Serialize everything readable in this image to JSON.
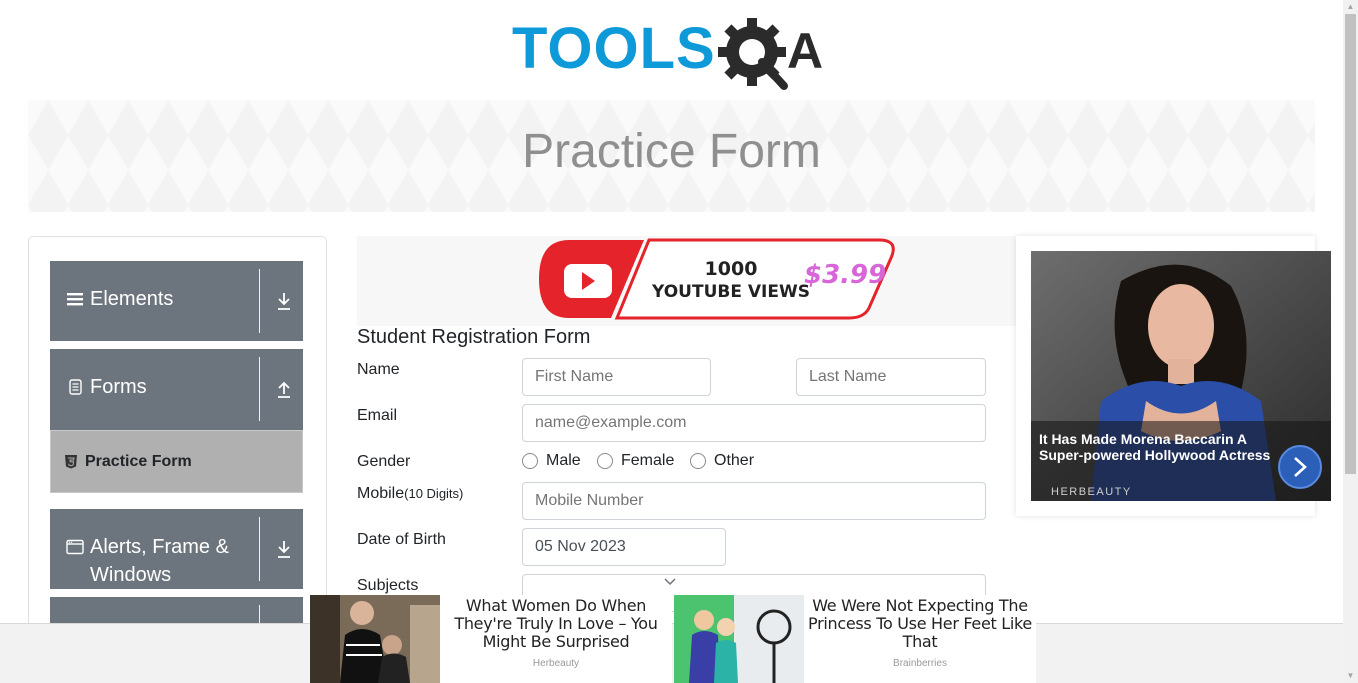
{
  "page": {
    "banner_title": "Practice Form"
  },
  "logo": {
    "text_left": "TOOLS",
    "text_right": "A",
    "color_primary": "#0e99d8",
    "color_dark": "#2b2b2b"
  },
  "sidebar": {
    "groups": [
      {
        "label": "Elements",
        "icon": "hamburger-icon",
        "toggle": "download-arrow-icon"
      },
      {
        "label": "Forms",
        "icon": "document-icon",
        "toggle": "upload-arrow-icon"
      },
      {
        "label": "Alerts, Frame & Windows",
        "icon": "window-icon",
        "toggle": "download-arrow-icon"
      }
    ],
    "active_item": {
      "label": "Practice Form",
      "icon": "html5-icon"
    }
  },
  "top_ad": {
    "line1": "1000",
    "line2": "YOUTUBE VIEWS",
    "price": "$3.99"
  },
  "form": {
    "title": "Student Registration Form",
    "name_label": "Name",
    "first_name_placeholder": "First Name",
    "last_name_placeholder": "Last Name",
    "email_label": "Email",
    "email_placeholder": "name@example.com",
    "gender_label": "Gender",
    "gender_options": [
      "Male",
      "Female",
      "Other"
    ],
    "mobile_label": "Mobile",
    "mobile_hint": "(10 Digits)",
    "mobile_placeholder": "Mobile Number",
    "dob_label": "Date of Birth",
    "dob_value": "05 Nov 2023",
    "subjects_label": "Subjects"
  },
  "side_ad": {
    "caption": "It Has Made Morena Baccarin A Super-powered Hollywood Actress",
    "brand": "HERBEAUTY"
  },
  "bottom_ads": [
    {
      "text": "What Women Do When They're Truly In Love – You Might Be Surprised",
      "source": "Herbeauty"
    },
    {
      "text": "We Were Not Expecting The Princess To Use Her Feet Like That",
      "source": "Brainberries"
    }
  ]
}
